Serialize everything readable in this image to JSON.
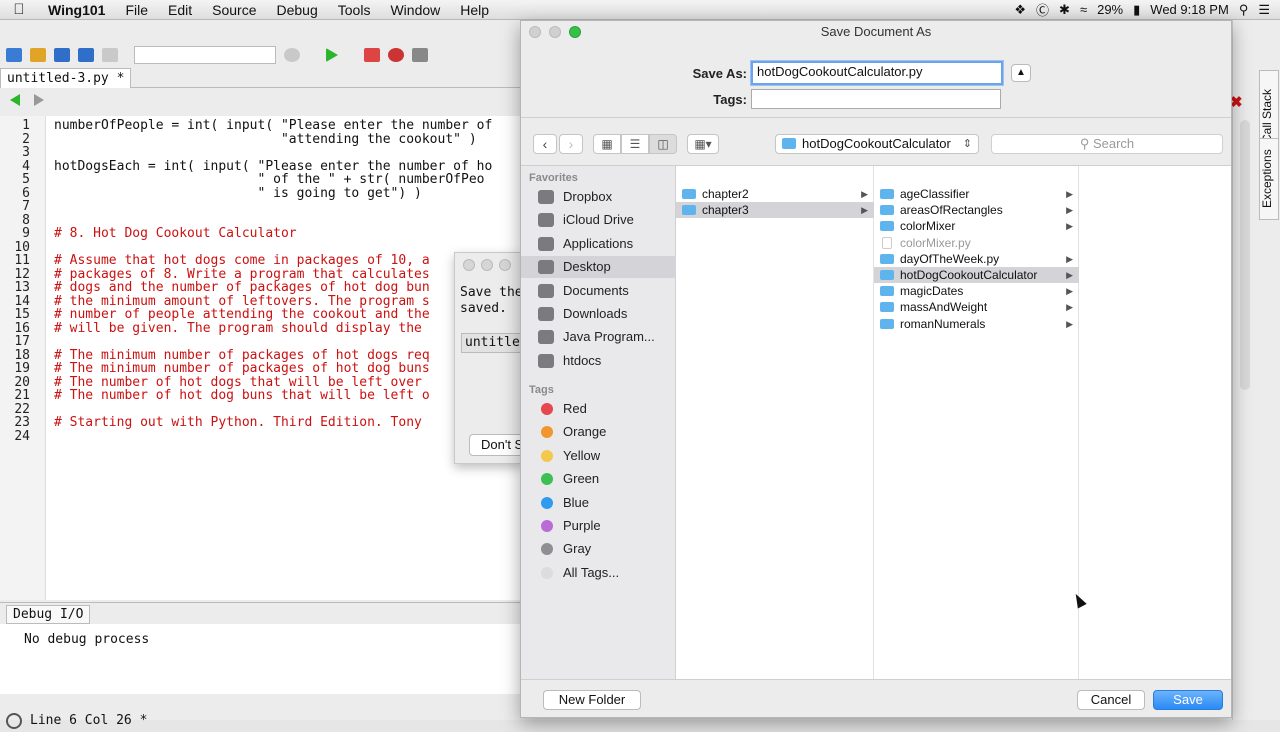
{
  "menubar": {
    "app_name": "Wing101",
    "items": [
      "File",
      "Edit",
      "Source",
      "Debug",
      "Tools",
      "Window",
      "Help"
    ],
    "battery": "29%",
    "clock": "Wed 9:18 PM"
  },
  "ide": {
    "tab_label": "untitled-3.py *",
    "code_lines": [
      {
        "n": "1",
        "text": "numberOfPeople = int( input( \"Please enter the number of",
        "comment": false
      },
      {
        "n": "2",
        "text": "                             \"attending the cookout\" )",
        "comment": false
      },
      {
        "n": "3",
        "text": "",
        "comment": false
      },
      {
        "n": "4",
        "text": "hotDogsEach = int( input( \"Please enter the number of ho",
        "comment": false
      },
      {
        "n": "5",
        "text": "                          \" of the \" + str( numberOfPeo",
        "comment": false
      },
      {
        "n": "6",
        "text": "                          \" is going to get\") )",
        "comment": false
      },
      {
        "n": "7",
        "text": "",
        "comment": false
      },
      {
        "n": "8",
        "text": "",
        "comment": false
      },
      {
        "n": "9",
        "text": "# 8. Hot Dog Cookout Calculator",
        "comment": true
      },
      {
        "n": "10",
        "text": "",
        "comment": false
      },
      {
        "n": "11",
        "text": "# Assume that hot dogs come in packages of 10, a",
        "comment": true
      },
      {
        "n": "12",
        "text": "# packages of 8. Write a program that calculates",
        "comment": true
      },
      {
        "n": "13",
        "text": "# dogs and the number of packages of hot dog bun",
        "comment": true
      },
      {
        "n": "14",
        "text": "# the minimum amount of leftovers. The program s",
        "comment": true
      },
      {
        "n": "15",
        "text": "# number of people attending the cookout and the",
        "comment": true
      },
      {
        "n": "16",
        "text": "# will be given. The program should display the",
        "comment": true
      },
      {
        "n": "17",
        "text": "",
        "comment": false
      },
      {
        "n": "18",
        "text": "# The minimum number of packages of hot dogs req",
        "comment": true
      },
      {
        "n": "19",
        "text": "# The minimum number of packages of hot dog buns",
        "comment": true
      },
      {
        "n": "20",
        "text": "# The number of hot dogs that will be left over",
        "comment": true
      },
      {
        "n": "21",
        "text": "# The number of hot dog buns that will be left o",
        "comment": true
      },
      {
        "n": "22",
        "text": "",
        "comment": false
      },
      {
        "n": "23",
        "text": "# Starting out with Python. Third Edition. Tony",
        "comment": true
      },
      {
        "n": "24",
        "text": "",
        "comment": false
      }
    ],
    "debug_tab": "Debug I/O",
    "debug_text": "No debug process",
    "status": "Line 6 Col 26 *",
    "side_tabs": [
      "Call Stack",
      "Exceptions"
    ]
  },
  "bg_dialog": {
    "text": "Save the\nsaved.",
    "input": "untitled",
    "button": "Don't Save"
  },
  "save_dialog": {
    "title": "Save Document As",
    "save_as_label": "Save As:",
    "filename": "hotDogCookoutCalculator.py",
    "tags_label": "Tags:",
    "tags_value": "",
    "location": "hotDogCookoutCalculator",
    "search_placeholder": "Search",
    "favorites_header": "Favorites",
    "favorites": [
      "Dropbox",
      "iCloud Drive",
      "Applications",
      "Desktop",
      "Documents",
      "Downloads",
      "Java Program...",
      "htdocs"
    ],
    "selected_favorite": "Desktop",
    "tags_header": "Tags",
    "tags": [
      {
        "name": "Red",
        "color": "#e5484d"
      },
      {
        "name": "Orange",
        "color": "#f0962d"
      },
      {
        "name": "Yellow",
        "color": "#f2c94c"
      },
      {
        "name": "Green",
        "color": "#3dbf52"
      },
      {
        "name": "Blue",
        "color": "#2f9bee"
      },
      {
        "name": "Purple",
        "color": "#b96bd6"
      },
      {
        "name": "Gray",
        "color": "#8e8e93"
      },
      {
        "name": "All Tags...",
        "color": "#dcdcdc"
      }
    ],
    "column1": [
      "chapter2",
      "chapter3"
    ],
    "column1_selected": "chapter3",
    "column2": [
      {
        "name": "ageClassifier",
        "type": "folder"
      },
      {
        "name": "areasOfRectangles",
        "type": "folder"
      },
      {
        "name": "colorMixer",
        "type": "folder"
      },
      {
        "name": "colorMixer.py",
        "type": "file"
      },
      {
        "name": "dayOfTheWeek.py",
        "type": "folder"
      },
      {
        "name": "hotDogCookoutCalculator",
        "type": "folder"
      },
      {
        "name": "magicDates",
        "type": "folder"
      },
      {
        "name": "massAndWeight",
        "type": "folder"
      },
      {
        "name": "romanNumerals",
        "type": "folder"
      }
    ],
    "column2_selected": "hotDogCookoutCalculator",
    "new_folder": "New Folder",
    "cancel": "Cancel",
    "save": "Save"
  }
}
